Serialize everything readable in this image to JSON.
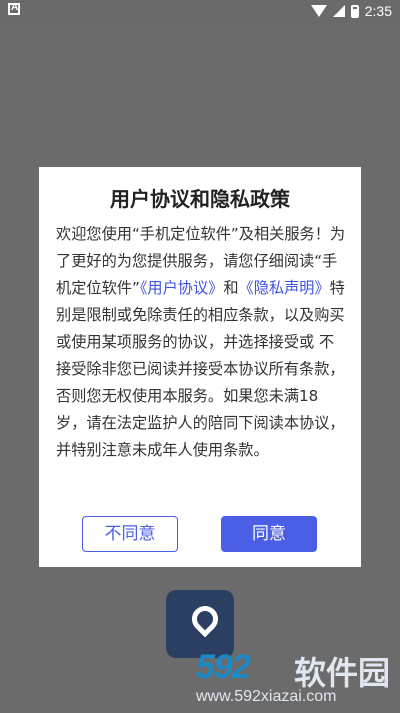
{
  "status_bar": {
    "time": "2:35",
    "left_icon": "a-icon",
    "wifi_icon": "wifi-icon",
    "signal_icon": "signal-icon",
    "battery_icon": "battery-icon"
  },
  "dialog": {
    "title": "用户协议和隐私政策",
    "body_part1": "欢迎您使用“手机定位软件”及相关服务！为了更好的为您提供服务，请您仔细阅读“手机定位软件”",
    "user_agreement_link": "《用户协议》",
    "and_text": "和",
    "privacy_link": "《隐私声明》",
    "body_part2": "特别是限制或免除责任的相应条款，以及购买或使用某项服务的协议，并选择接受或 不接受除非您已阅读并接受本协议所有条款，否则您无权使用本服务。如果您未满18岁，请在法定监护人的陪同下阅读本协议，并特别注意未成年人使用条款。",
    "disagree_label": "不同意",
    "agree_label": "同意"
  },
  "background": {
    "app_icon": "location-pin-icon"
  },
  "watermark": {
    "logo": "592",
    "name": "软件园",
    "url": "www.592xiazai.com"
  },
  "colors": {
    "accent": "#4a5ee6",
    "overlay": "#6b6b6b",
    "watermark_blue": "#1c89c9"
  }
}
